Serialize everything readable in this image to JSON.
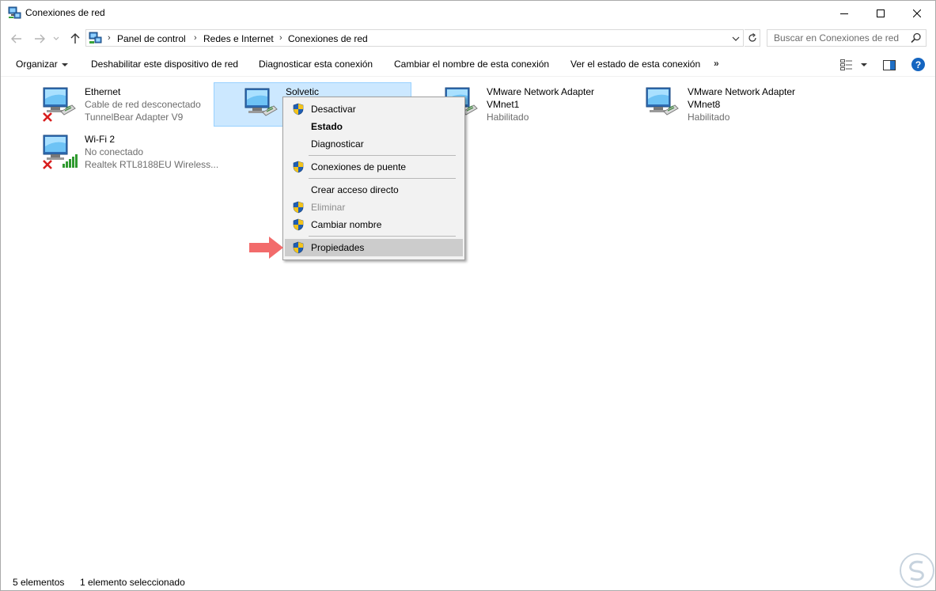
{
  "window": {
    "title": "Conexiones de red"
  },
  "address": {
    "crumbs": [
      "Panel de control",
      "Redes e Internet",
      "Conexiones de red"
    ]
  },
  "search": {
    "placeholder": "Buscar en Conexiones de red"
  },
  "toolbar": {
    "organize": "Organizar",
    "disable": "Deshabilitar este dispositivo de red",
    "diagnose": "Diagnosticar esta conexión",
    "rename": "Cambiar el nombre de esta conexión",
    "status": "Ver el estado de esta conexión",
    "more": "»",
    "help": "?"
  },
  "connections": [
    {
      "name": "Ethernet",
      "line1": "Cable de red desconectado",
      "line2": "TunnelBear Adapter V9",
      "state": "disconnected",
      "type": "ethernet"
    },
    {
      "name": "Solvetic",
      "line1": "",
      "line2": "",
      "state": "selected",
      "type": "ethernet"
    },
    {
      "name": "VMware Network Adapter",
      "line1": "VMnet1",
      "line2": "Habilitado",
      "state": "enabled",
      "type": "ethernet"
    },
    {
      "name": "VMware Network Adapter",
      "line1": "VMnet8",
      "line2": "Habilitado",
      "state": "enabled",
      "type": "ethernet"
    },
    {
      "name": "Wi-Fi 2",
      "line1": "No conectado",
      "line2": "Realtek RTL8188EU Wireless...",
      "state": "disconnected",
      "type": "wifi"
    }
  ],
  "context_menu": {
    "items": [
      {
        "label": "Desactivar",
        "shield": true,
        "bold": false,
        "disabled": false
      },
      {
        "label": "Estado",
        "shield": false,
        "bold": true,
        "disabled": false
      },
      {
        "label": "Diagnosticar",
        "shield": false,
        "bold": false,
        "disabled": false
      },
      {
        "label": "Conexiones de puente",
        "shield": true,
        "bold": false,
        "disabled": false
      },
      {
        "label": "Crear acceso directo",
        "shield": false,
        "bold": false,
        "disabled": false
      },
      {
        "label": "Eliminar",
        "shield": true,
        "bold": false,
        "disabled": true
      },
      {
        "label": "Cambiar nombre",
        "shield": true,
        "bold": false,
        "disabled": false
      },
      {
        "label": "Propiedades",
        "shield": true,
        "bold": false,
        "disabled": false,
        "highlighted": true
      }
    ]
  },
  "status_bar": {
    "count": "5 elementos",
    "selected": "1 elemento seleccionado"
  },
  "colors": {
    "selection_bg": "#cce8ff",
    "menu_highlight": "#cccccc",
    "pointer_arrow": "#f26b6b",
    "help": "#1565c0"
  },
  "icons": {
    "app": "network-connections-icon",
    "back": "arrow-left-icon",
    "forward": "arrow-right-icon",
    "up": "arrow-up-icon",
    "refresh": "refresh-icon",
    "search": "search-icon",
    "shield": "uac-shield-icon"
  }
}
